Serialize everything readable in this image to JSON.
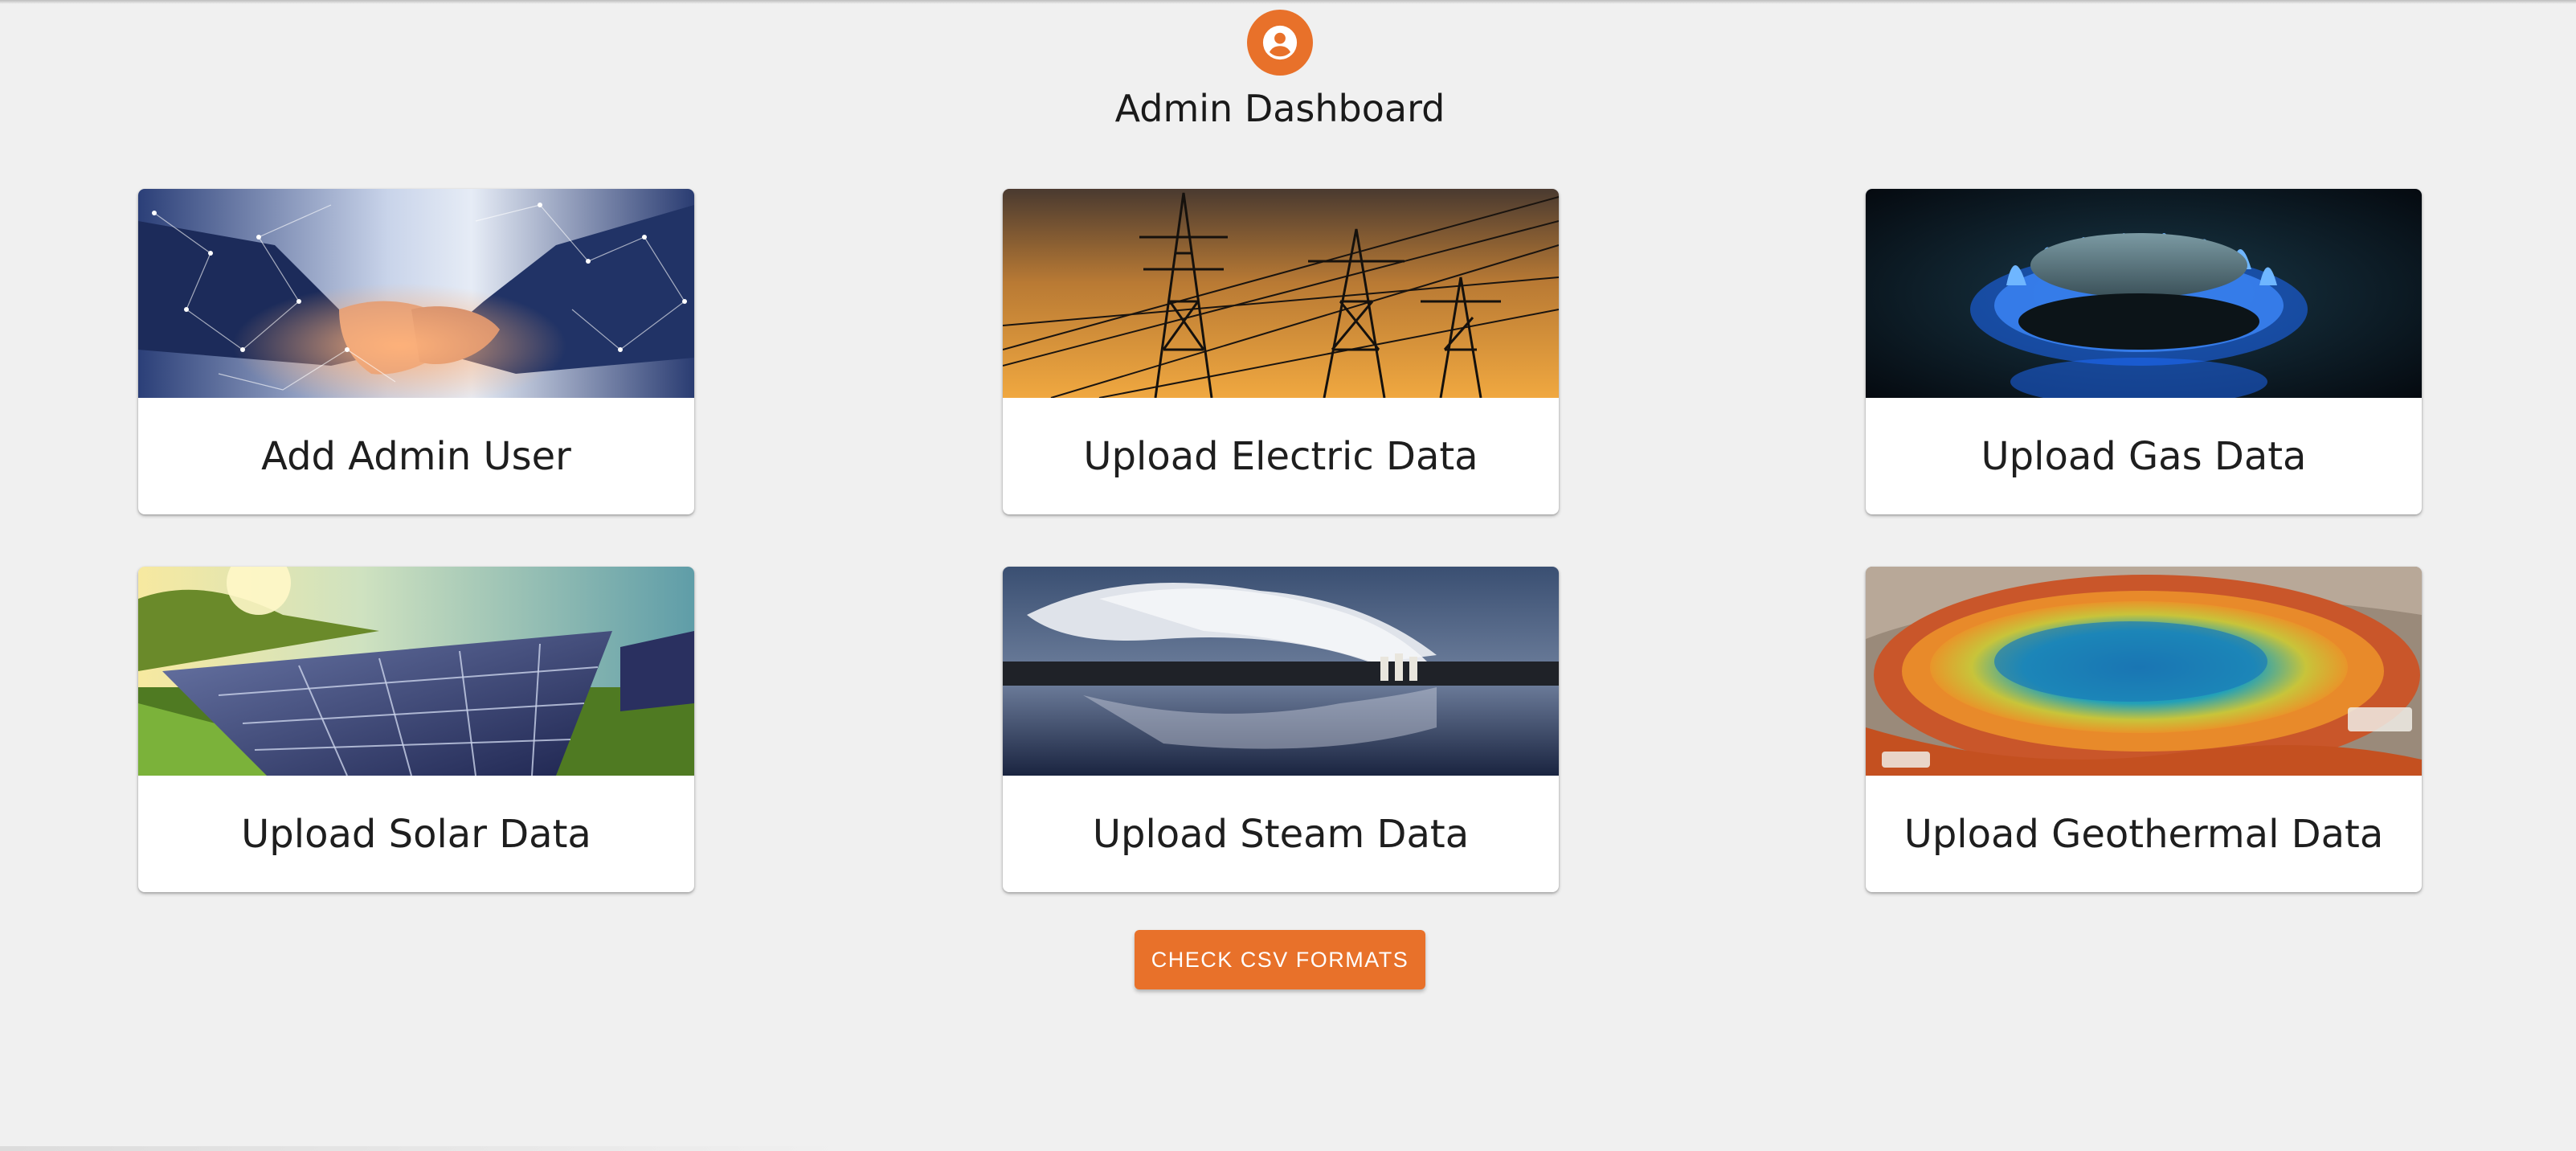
{
  "header": {
    "title": "Admin Dashboard",
    "avatar_icon": "account-circle-icon",
    "avatar_color": "#e8712a"
  },
  "cards": [
    {
      "label": "Add Admin User",
      "image": "handshake-network-image"
    },
    {
      "label": "Upload Electric Data",
      "image": "power-lines-sunset-image"
    },
    {
      "label": "Upload Gas Data",
      "image": "gas-burner-flame-image"
    },
    {
      "label": "Upload Solar Data",
      "image": "solar-panels-field-image"
    },
    {
      "label": "Upload Steam Data",
      "image": "steam-plant-lake-image"
    },
    {
      "label": "Upload Geothermal Data",
      "image": "geothermal-spring-image"
    }
  ],
  "actions": {
    "csv_button_label": "CHECK CSV FORMATS",
    "accent_color": "#e8712a"
  },
  "colors": {
    "background": "#f0f0f0",
    "card": "#ffffff",
    "text": "#1e1e1e"
  }
}
